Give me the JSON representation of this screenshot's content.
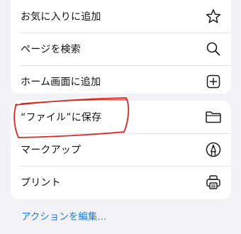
{
  "menu": {
    "top_group": [
      {
        "label": "お気に入りに追加",
        "icon": "star-icon"
      },
      {
        "label": "ページを検索",
        "icon": "search-icon"
      },
      {
        "label": "ホーム画面に追加",
        "icon": "add-square-icon"
      }
    ],
    "bottom_group": [
      {
        "label": "“ファイル”に保存",
        "icon": "folder-icon"
      },
      {
        "label": "マークアップ",
        "icon": "markup-pen-icon"
      },
      {
        "label": "プリント",
        "icon": "printer-icon"
      }
    ]
  },
  "footer": {
    "edit_actions_label": "アクションを編集..."
  },
  "colors": {
    "background": "#f2f2f7",
    "card": "#ffffff",
    "link": "#1f7ae0",
    "annotation": "#d9271f"
  }
}
